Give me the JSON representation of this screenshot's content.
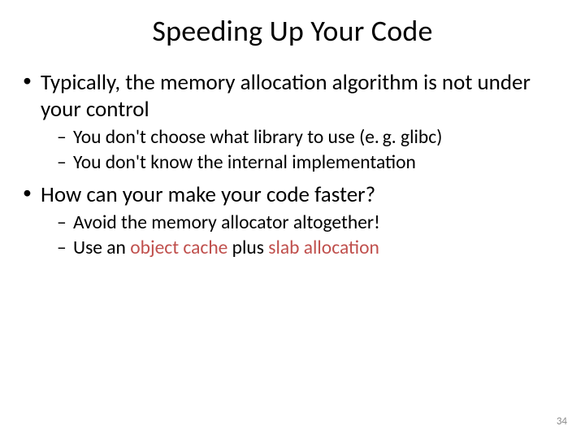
{
  "title": "Speeding Up Your Code",
  "bullets": {
    "b1": "Typically, the memory allocation algorithm is not under your control",
    "b1a": "You don't choose what library to use (e. g. glibc)",
    "b1b": "You don't know the internal implementation",
    "b2": "How can your make your code faster?",
    "b2a": "Avoid the memory allocator altogether!",
    "b2b_pre": "Use an ",
    "b2b_obj": "object cache",
    "b2b_mid": " plus ",
    "b2b_slab": "slab allocation"
  },
  "page_number": "34"
}
